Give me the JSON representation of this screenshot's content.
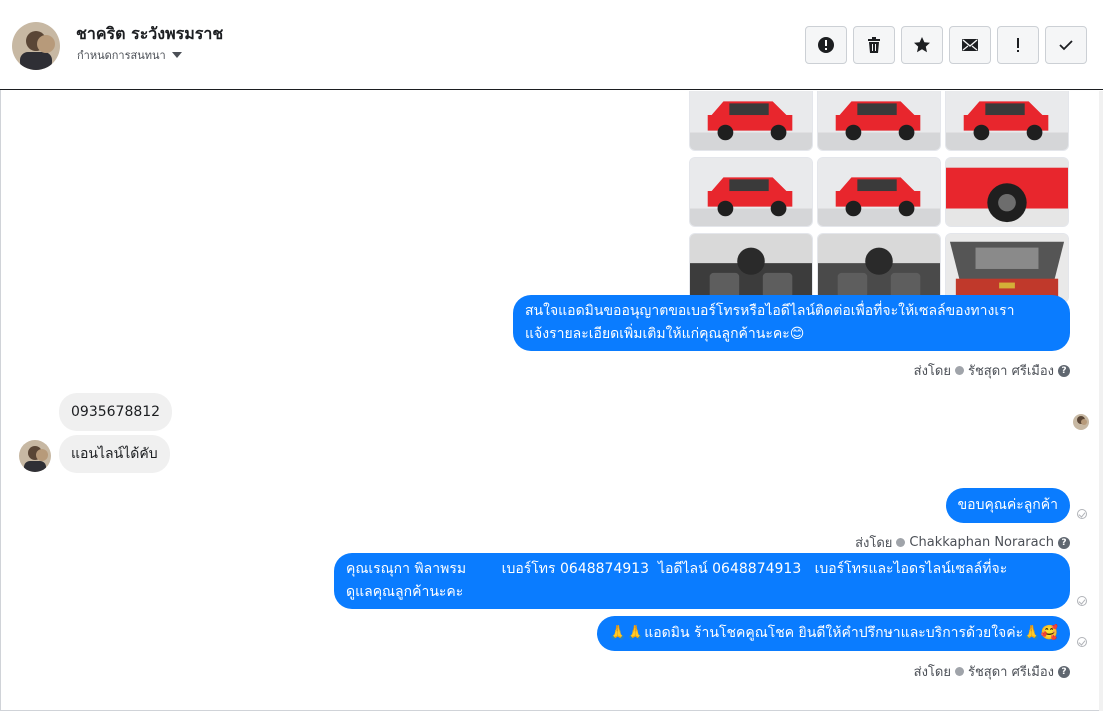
{
  "header": {
    "contact_name": "ชาคริต ระวังพรมราช",
    "assign_label": "กำหนดการสนทนา",
    "toolbar": [
      {
        "icon": "alert-circle-icon",
        "name": "spam-button"
      },
      {
        "icon": "trash-icon",
        "name": "delete-button"
      },
      {
        "icon": "star-icon",
        "name": "star-button"
      },
      {
        "icon": "envelope-icon",
        "name": "mark-unread-button"
      },
      {
        "icon": "exclamation-icon",
        "name": "follow-up-button"
      },
      {
        "icon": "checkmark-icon",
        "name": "done-button"
      }
    ]
  },
  "thread": {
    "photos": [
      {
        "color": "#e8262d",
        "view": "front"
      },
      {
        "color": "#e8262d",
        "view": "front"
      },
      {
        "color": "#e8262d",
        "view": "front"
      },
      {
        "color": "#e8262d",
        "view": "rear"
      },
      {
        "color": "#e8262d",
        "view": "side"
      },
      {
        "color": "#e8262d",
        "view": "wheel"
      },
      {
        "color": "#3c3c3c",
        "view": "dashboard"
      },
      {
        "color": "#4a4a4a",
        "view": "interior"
      },
      {
        "color": "#c0392b",
        "view": "engine"
      }
    ],
    "msg_request_line1": "สนใจแอดมินขออนุญาตขอเบอร์โทรหรือไอดีไลน์ติดต่อเพื่อที่จะให้เซลล์ของทางเรา",
    "msg_request_line2": "แจ้งรายละเอียดเพิ่มเติมให้แก่คุณลูกค้านะคะ😊",
    "sent_by_label": "ส่งโดย",
    "agent_1": "รัชสุดา ศรีเมือง",
    "in_phone": "0935678812",
    "in_line": "แอนไลน์ได้คับ",
    "msg_thanks": "ขอบคุณค่ะลูกค้า",
    "agent_2": "Chakkaphan Norarach",
    "msg_contact_line1": "คุณเรณุกา พิลาพรม        เบอร์โทร 0648874913  ไอดีไลน์ 0648874913   เบอร์โทรและไอดรไลน์เซลล์ที่จะ",
    "msg_contact_line2": "ดูแลคุณลูกค้านะคะ",
    "msg_closing": "🙏🙏แอดมิน ร้านโชคคูณโชค ยินดีให้คำปรึกษาและบริการด้วยใจค่ะ🙏🥰",
    "agent_3": "รัชสุดา ศรีเมือง"
  },
  "colors": {
    "outgoing_bubble": "#0a7cff",
    "incoming_bubble": "#f0f0f0"
  }
}
